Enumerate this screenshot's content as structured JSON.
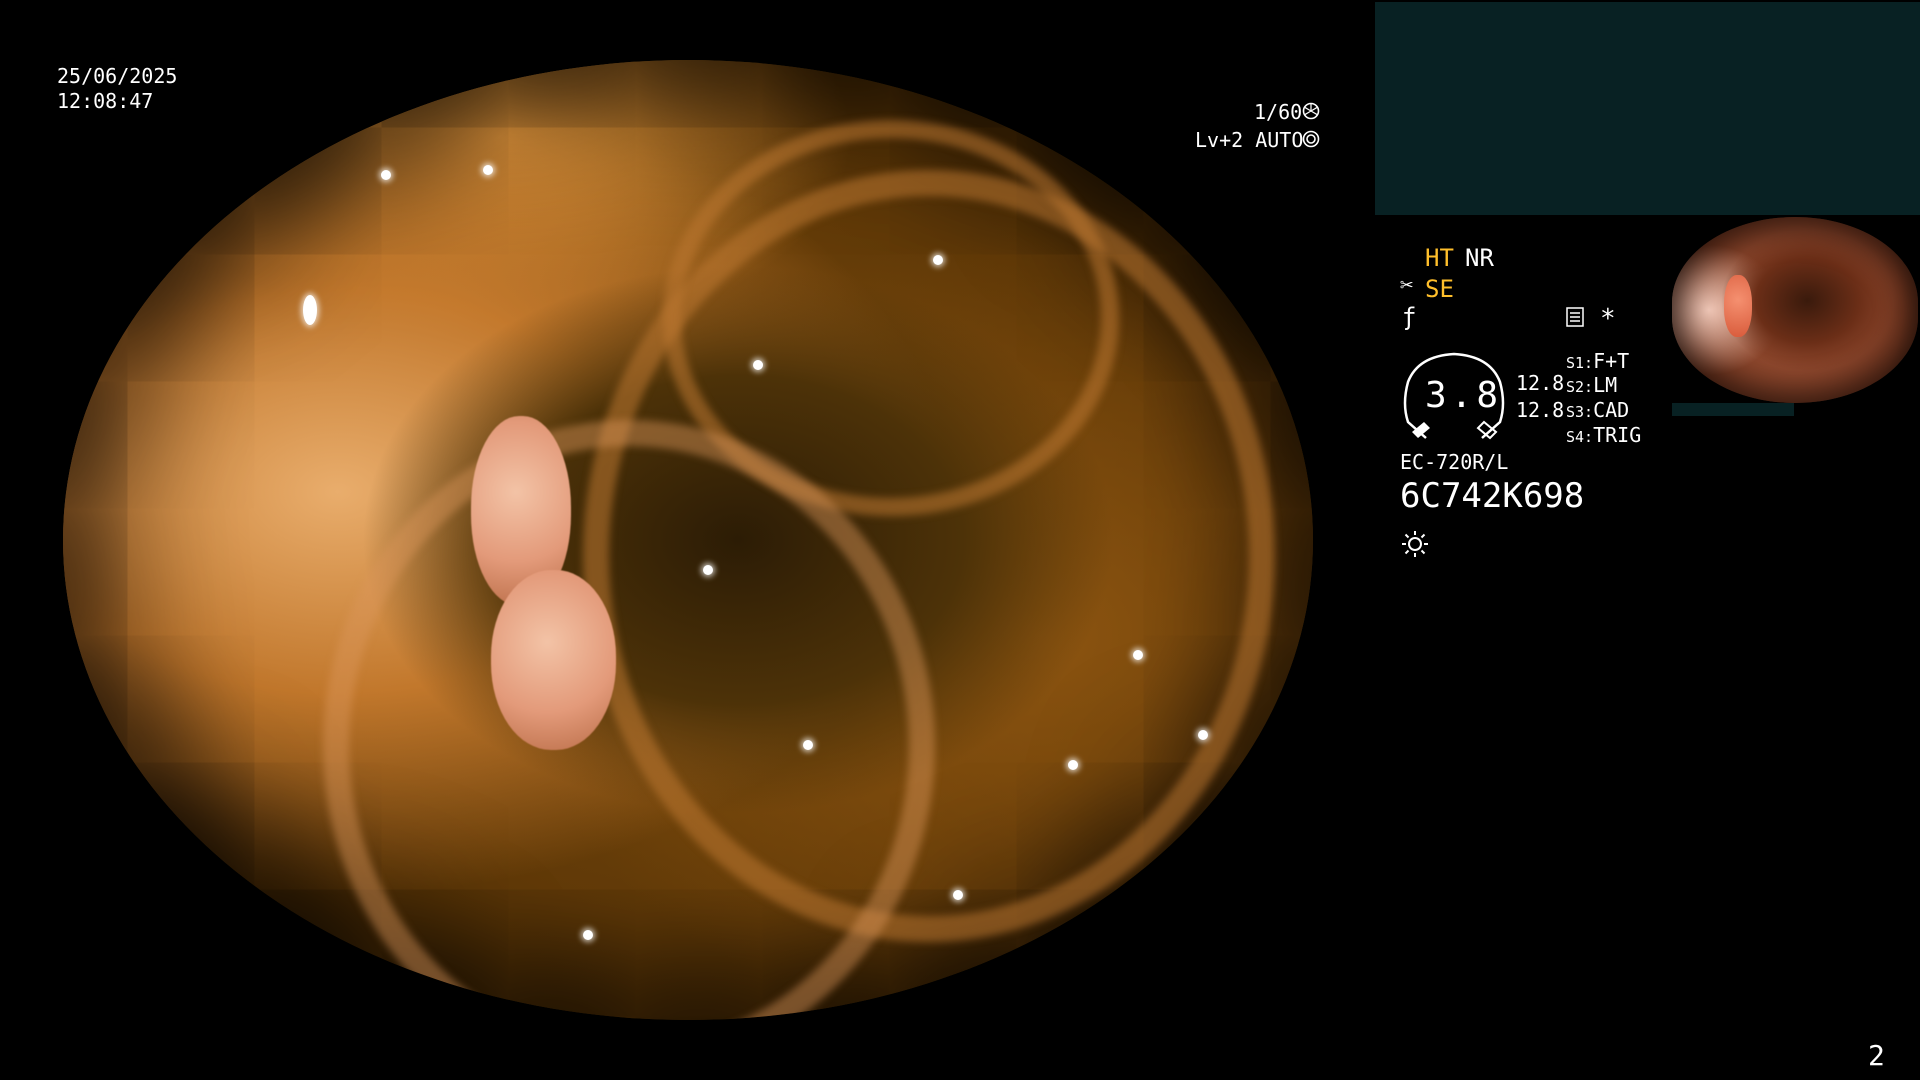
{
  "overlay": {
    "date": "25/06/2025",
    "time": "12:08:47",
    "shutter": "1/60",
    "level": "Lv+2 AUTO",
    "page_number": "2"
  },
  "status": {
    "ht": "HT",
    "nr": "NR",
    "se": "SE",
    "gauge_value": "3.8",
    "value_top": "12.8",
    "value_bottom": "12.8",
    "switches": [
      {
        "key": "S1:",
        "value": "F+T"
      },
      {
        "key": "S2:",
        "value": "LM"
      },
      {
        "key": "S3:",
        "value": "CAD"
      },
      {
        "key": "S4:",
        "value": "TRIG"
      }
    ],
    "scope_model": "EC-720R/L",
    "scope_serial": "6C742K698"
  },
  "colors": {
    "accent_yellow": "#ffbf2b",
    "panel_dark": "#082123",
    "text": "#ffffff"
  },
  "icons": [
    "shutter-wheel-icon",
    "auto-iris-icon",
    "scissors-icon",
    "f-slash-icon",
    "document-icon",
    "asterisk-icon",
    "gauge-icon",
    "light-sun-icon"
  ]
}
